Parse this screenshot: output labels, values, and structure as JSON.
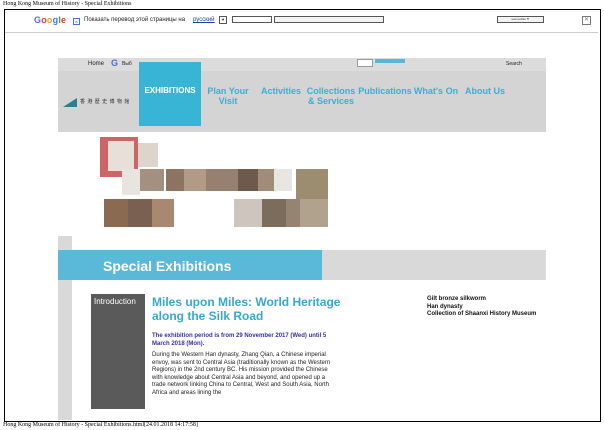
{
  "page_header": "Hong Kong Museum of History - Special Exhibitions",
  "page_footer": "Hong Kong Museum of History - Special Exhibitions.html[24.01.2018 14:17:58]",
  "translate_bar": {
    "logo": "Google",
    "prompt": "Показать перевод этой страницы на",
    "language": "русский",
    "settings_label": "настройки ▼"
  },
  "topbar": {
    "home": "Home",
    "google_icon": "google-g-icon",
    "google_text": "Выб",
    "search": "Search"
  },
  "logo": {
    "text": "香 港 歷 史 博 物 館"
  },
  "nav": {
    "items": [
      {
        "label": "EXHIBITIONS"
      },
      {
        "label": "Plan Your Visit"
      },
      {
        "label": "Activities"
      },
      {
        "label": "Collections & Services"
      },
      {
        "label": "Publications"
      },
      {
        "label": "What's On"
      },
      {
        "label": "About Us"
      }
    ]
  },
  "section_title": "Special Exhibitions",
  "intro_label": "Introduction",
  "article": {
    "title": "Miles upon Miles: World Heritage along the Silk Road",
    "period": "The exhibition period is from 29 November 2017 (Wed) until 5 March 2018 (Mon).",
    "body": "During the Western Han dynasty, Zhang Qian, a Chinese imperial envoy, was sent to Central Asia (traditionally known as the Western Regions) in the 2nd century BC. His mission provided the Chinese with knowledge about Central Asia and beyond, and opened up a trade network linking China to Central, West and South Asia, North Africa and areas lining the"
  },
  "caption": {
    "line1": "Gilt bronze silkworm",
    "line2": "Han dynasty",
    "line3": "Collection of Shaanxi History Museum"
  },
  "colors": {
    "accent": "#38b4d4",
    "band": "#5ab9d9",
    "grey": "#d9d9d9",
    "intro": "#5a5a5a",
    "period_text": "#3a2fa0"
  }
}
